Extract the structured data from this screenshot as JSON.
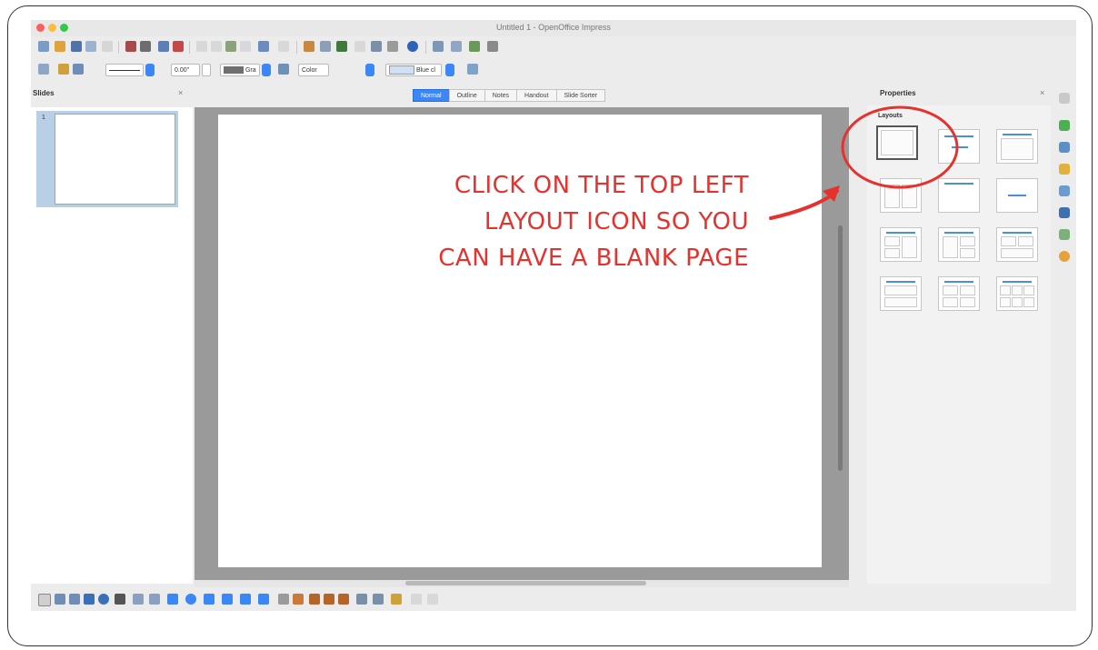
{
  "window": {
    "title": "Untitled 1 - OpenOffice Impress"
  },
  "toolbar2": {
    "line_width": "0.00\"",
    "line_color_label": "Gra",
    "fill_type": "Color",
    "fill_color": "Blue cl"
  },
  "slides_panel": {
    "title": "Slides",
    "close": "×",
    "slide_number": "1"
  },
  "view_tabs": [
    {
      "label": "Normal",
      "active": true
    },
    {
      "label": "Outline",
      "active": false
    },
    {
      "label": "Notes",
      "active": false
    },
    {
      "label": "Handout",
      "active": false
    },
    {
      "label": "Slide Sorter",
      "active": false
    }
  ],
  "properties_panel": {
    "title": "Properties",
    "close": "×",
    "section": "Layouts"
  },
  "annotation": {
    "lines": [
      "CLICK ON THE TOP LEFT",
      "LAYOUT ICON SO YOU",
      "CAN HAVE A BLANK PAGE"
    ],
    "color": "#e5322d"
  },
  "colors": {
    "accent": "#3b87f7",
    "window_bg": "#ececec",
    "workarea": "#9a9a9a",
    "annotation": "#e5322d"
  }
}
